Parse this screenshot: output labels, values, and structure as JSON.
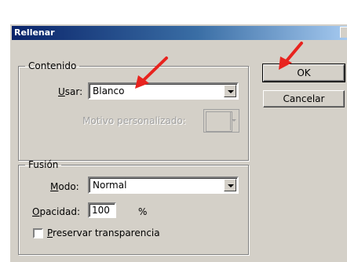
{
  "window": {
    "title": "Rellenar"
  },
  "contenido": {
    "legend": "Contenido",
    "usar_label_u": "U",
    "usar_label_rest": "sar:",
    "usar_value": "Blanco",
    "motivo_label": "Motivo personalizado:"
  },
  "fusion": {
    "legend": "Fusión",
    "modo_label_u": "M",
    "modo_label_rest": "odo:",
    "modo_value": "Normal",
    "opacidad_label_u": "O",
    "opacidad_label_rest": "pacidad:",
    "opacidad_value": "100",
    "opacidad_unit": "%",
    "preservar_label_u": "P",
    "preservar_label_rest": "reservar transparencia",
    "preservar_checked": false
  },
  "buttons": {
    "ok": "OK",
    "cancel": "Cancelar"
  },
  "annotations": {
    "arrow_color": "#e8231e"
  }
}
